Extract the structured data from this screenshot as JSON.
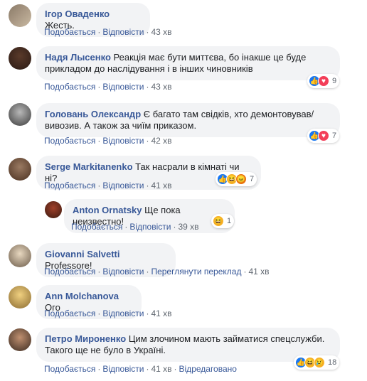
{
  "actions": {
    "like": "Подобається",
    "reply": "Відповісти",
    "translate": "Переглянути переклад",
    "edited": "Відредаговано",
    "sep": "·"
  },
  "comments": [
    {
      "author": "Ігор Оваденко",
      "text": "Жесть.",
      "time": "43 хв"
    },
    {
      "author": "Надя Лысенко",
      "text": "Реакція має бути миттєва, бо інакше це буде прикладом до наслідування і в інших чиновників",
      "time": "43 хв",
      "reactions_count": "9"
    },
    {
      "author": "Головань Олександр",
      "text": "Є багато там свідків, хто демонтовував/вивозив. А також за чиїм приказом.",
      "time": "42 хв",
      "reactions_count": "7"
    },
    {
      "author": "Serge Markitanenko",
      "text": "Так насрали в кімнаті чи ні?",
      "time": "41 хв",
      "reactions_count": "7"
    },
    {
      "author": "Anton Ornatsky",
      "text": "Ще пока неизвестно!",
      "time": "39 хв",
      "reactions_count": "1"
    },
    {
      "author": "Giovanni Salvetti",
      "text": "Professore!",
      "time": "41 хв"
    },
    {
      "author": "Ann Molchanova",
      "text": "Ого",
      "time": "41 хв"
    },
    {
      "author": "Петро Мироненко",
      "text": "Цим злочином мають займатися спецслужби. Такого ще не було в Україні.",
      "time": "41 хв",
      "reactions_count": "18"
    }
  ],
  "colors": {
    "link": "#385898",
    "bubble": "#f2f3f5",
    "meta": "#606770"
  }
}
